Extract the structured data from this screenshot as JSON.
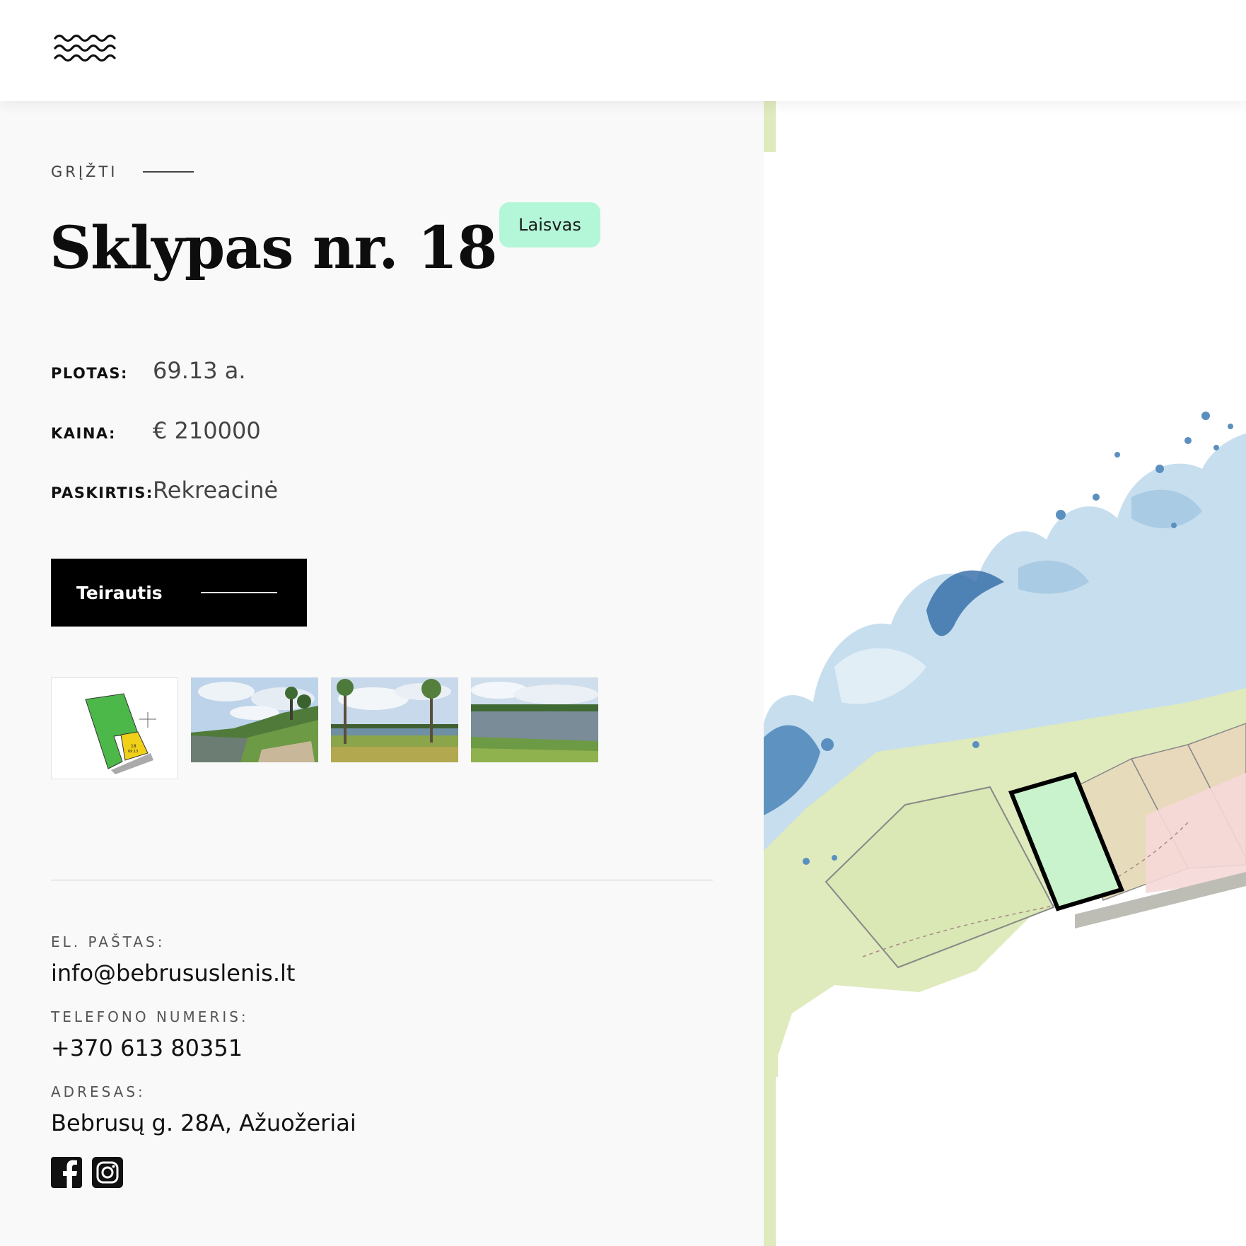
{
  "header": {
    "logo_icon": "waves-logo-icon"
  },
  "back": {
    "label": "GRĮŽTI"
  },
  "plot": {
    "title": "Sklypas nr. 18",
    "status": "Laisvas",
    "status_color": "#b3f7d8"
  },
  "specs": [
    {
      "label": "PLOTAS:",
      "value": "69.13 a."
    },
    {
      "label": "KAINA:",
      "value": "€ 210000"
    },
    {
      "label": "PASKIRTIS:",
      "value": "Rekreacinė"
    }
  ],
  "cta": {
    "label": "Teirautis"
  },
  "gallery": [
    {
      "kind": "plan",
      "plan_label": "18\n69.13"
    },
    {
      "kind": "photo"
    },
    {
      "kind": "photo"
    },
    {
      "kind": "photo"
    }
  ],
  "contacts": {
    "email_label": "EL. PAŠTAS:",
    "email": "info@bebrususlenis.lt",
    "phone_label": "TELEFONO NUMERIS:",
    "phone": "+370 613 80351",
    "address_label": "ADRESAS:",
    "address": "Bebrusų g. 28A, Ažuožeriai"
  },
  "social": [
    {
      "icon": "facebook-icon"
    },
    {
      "icon": "instagram-icon"
    }
  ],
  "colors": {
    "accent": "#000000",
    "map_water": "#bcd8ea",
    "map_land": "#dfeabd",
    "selected_plot": "#c9f3cc"
  }
}
